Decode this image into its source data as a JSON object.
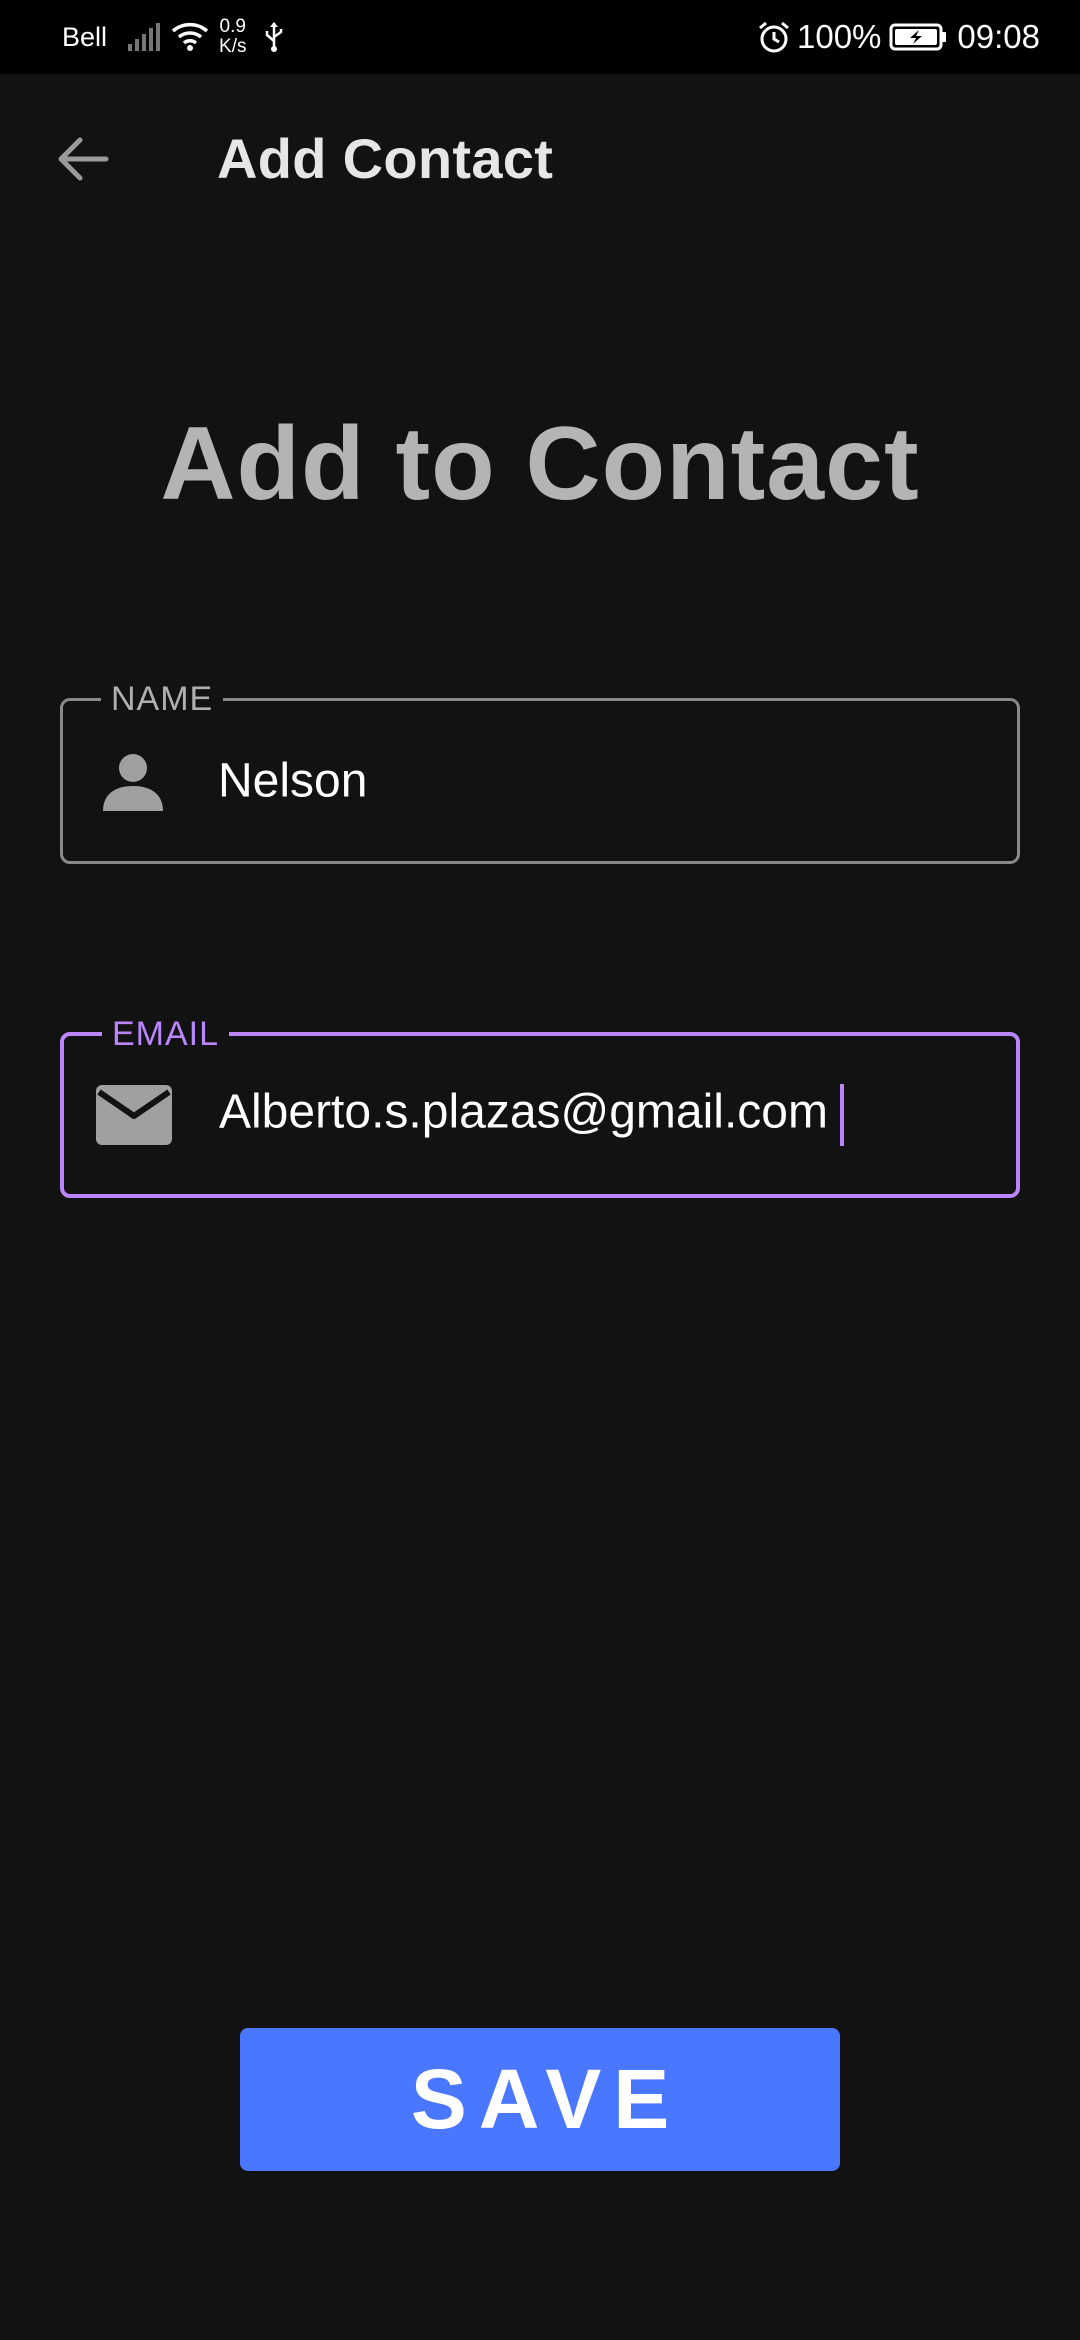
{
  "status_bar": {
    "carrier": "Bell",
    "net_speed_value": "0.9",
    "net_speed_unit": "K/s",
    "battery_percent": "100%",
    "time": "09:08",
    "icons": [
      "signal-icon",
      "wifi-icon",
      "usb-icon",
      "alarm-icon",
      "battery-charging-icon"
    ]
  },
  "app_bar": {
    "title": "Add Contact",
    "back_icon": "arrow-left-icon"
  },
  "heading": "Add to Contact",
  "form": {
    "name_field": {
      "label": "NAME",
      "value": "Nelson",
      "icon": "person-icon"
    },
    "email_field": {
      "label": "EMAIL",
      "value": "Alberto.s.plazas@gmail.com",
      "icon": "mail-icon",
      "focused": true
    }
  },
  "save_button": {
    "label": "SAVE"
  },
  "colors": {
    "background": "#121212",
    "status_bar": "#000000",
    "accent_focus": "#bb86fc",
    "button": "#4a77ff",
    "heading": "#b4b4b4",
    "icon": "#a0a0a0"
  }
}
